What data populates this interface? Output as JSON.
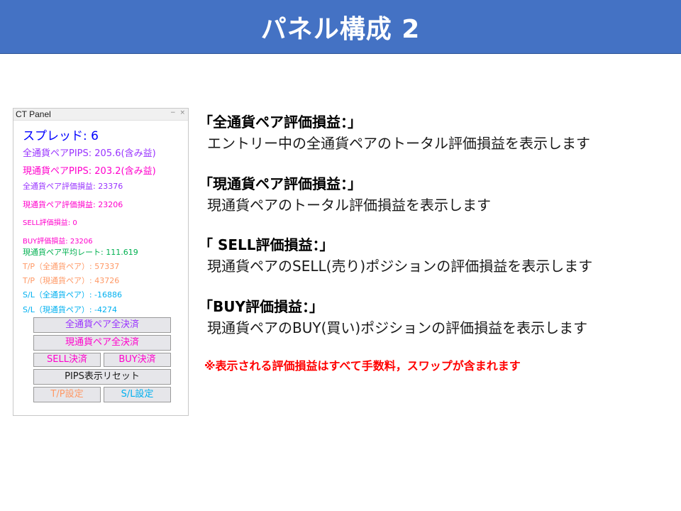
{
  "slide_title": "パネル構成 2",
  "panel": {
    "title": "CT Panel",
    "controls": [
      "−",
      "×"
    ],
    "spread": "スプレッド: 6",
    "all_pips": "全通貨ペアPIPS: 205.6(含み益)",
    "cur_pips": "現通貨ペアPIPS: 203.2(含み益)",
    "all_pl": "全通貨ペア評価損益: 23376",
    "cur_pl": "現通貨ペア評価損益: 23206",
    "sell_pl": "SELL評価損益: 0",
    "buy_pl": "BUY評価損益: 23206",
    "avg_rate": "現通貨ペア平均レート: 111.619",
    "tp_all": "T/P（全通貨ペア）: 57337",
    "tp_cur": "T/P（現通貨ペア）: 43726",
    "sl_all": "S/L（全通貨ペア）: -16886",
    "sl_cur": "S/L（現通貨ペア）: -4274",
    "btn_close_all": "全通貨ペア全決済",
    "btn_close_cur": "現通貨ペア全決済",
    "btn_sell_close": "SELL決済",
    "btn_buy_close": "BUY決済",
    "btn_pips_reset": "PIPS表示リセット",
    "btn_tp_set": "T/P設定",
    "btn_sl_set": "S/L設定"
  },
  "descriptions": [
    {
      "head": "「全通貨ペア評価損益：」",
      "body": "エントリー中の全通貨ペアのトータル評価損益を表示します"
    },
    {
      "head": "「現通貨ペア評価損益：」",
      "body": "現通貨ペアのトータル評価損益を表示します"
    },
    {
      "head": "「 SELL評価損益：」",
      "body": "現通貨ペアのSELL(売り)ポジションの評価損益を表示します"
    },
    {
      "head": "「BUY評価損益：」",
      "body": "現通貨ペアのBUY(買い)ポジションの評価損益を表示します"
    }
  ],
  "note": "※表示される評価損益はすべて手数料，スワップが含まれます",
  "colors": {
    "title_bg": "#4472c4",
    "spread": "#0000ff",
    "purple": "#9933ff",
    "magenta": "#ff00cc",
    "green": "#00b050",
    "orange": "#ff9966",
    "cyan": "#00b0f0",
    "note": "#ff0000"
  }
}
